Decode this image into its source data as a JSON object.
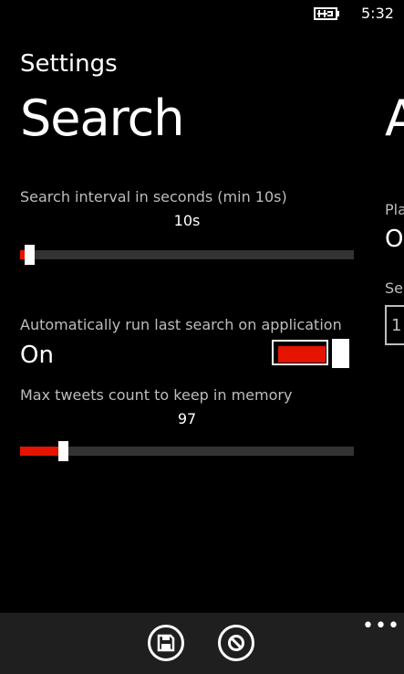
{
  "status": {
    "time": "5:32",
    "battery_icon": "battery-charging-icon"
  },
  "app_title": "Settings",
  "pivot": {
    "current": "Search",
    "next": "A"
  },
  "search_interval": {
    "label": "Search interval in seconds (min 10s)",
    "value": "10s",
    "level": 0.02
  },
  "auto_run": {
    "label": "Automatically run last search on application start",
    "state": "On",
    "on": true
  },
  "max_tweets": {
    "label": "Max tweets count to keep in memory",
    "value": "97",
    "level": 0.12
  },
  "next_page": {
    "label1": "Pla",
    "value1": "O",
    "label2": "Sel",
    "box_value": "1"
  },
  "app_bar": {
    "save_icon": "save-icon",
    "cancel_icon": "cancel-icon",
    "more_icon": "more-dots-icon"
  },
  "colors": {
    "accent": "#e51400",
    "background": "#000000",
    "appbar": "#1f1f1f"
  }
}
